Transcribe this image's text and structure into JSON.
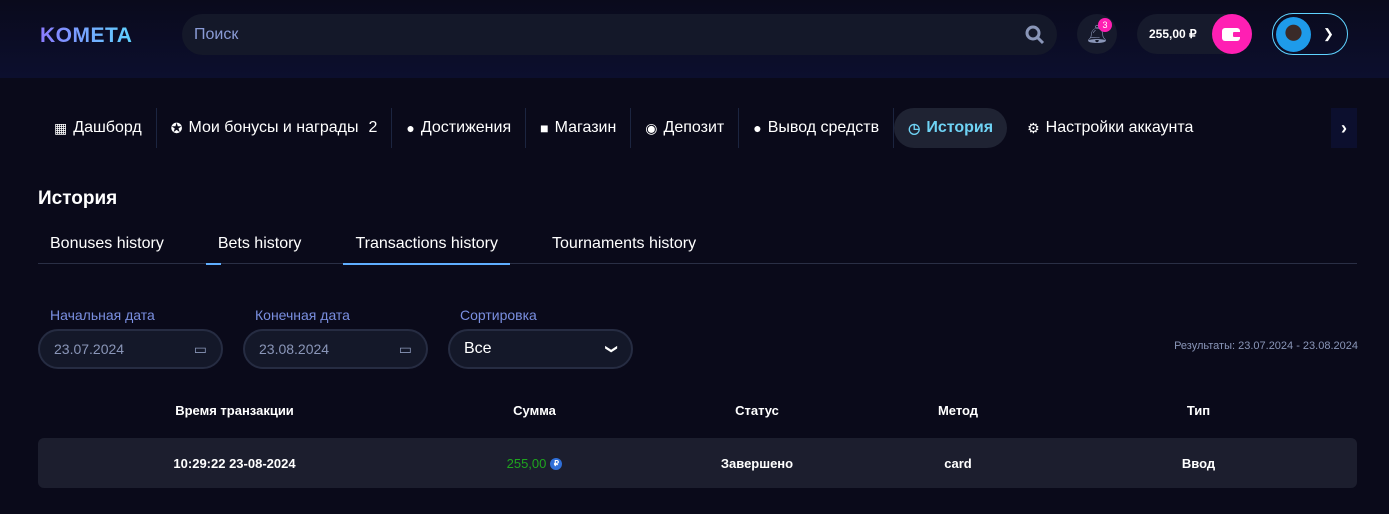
{
  "header": {
    "logo": "KOMETA",
    "search_placeholder": "Поиск",
    "notifications_count": "3",
    "balance": "255,00 ₽"
  },
  "nav": {
    "items": [
      {
        "label": "Дашборд",
        "icon": "dashboard-icon"
      },
      {
        "label": "Мои бонусы и награды",
        "count": "2",
        "icon": "gift-icon"
      },
      {
        "label": "Достижения",
        "icon": "award-icon"
      },
      {
        "label": "Магазин",
        "icon": "shop-icon"
      },
      {
        "label": "Депозит",
        "icon": "deposit-icon"
      },
      {
        "label": "Вывод средств",
        "icon": "money-bag-icon"
      },
      {
        "label": "История",
        "icon": "history-icon",
        "active": true
      },
      {
        "label": "Настройки аккаунта",
        "icon": "gear-icon"
      }
    ]
  },
  "page_title": "История",
  "tabs": [
    {
      "label": "Bonuses history"
    },
    {
      "label": "Bets history"
    },
    {
      "label": "Transactions history",
      "active": true
    },
    {
      "label": "Tournaments history"
    }
  ],
  "filters": {
    "start_label": "Начальная дата",
    "start_value": "23.07.2024",
    "end_label": "Конечная дата",
    "end_value": "23.08.2024",
    "sort_label": "Сортировка",
    "sort_value": "Все"
  },
  "results": "Результаты: 23.07.2024 - 23.08.2024",
  "table": {
    "headers": [
      "Время транзакции",
      "Сумма",
      "Статус",
      "Метод",
      "Тип"
    ],
    "rows": [
      {
        "time": "10:29:22 23-08-2024",
        "amount": "255,00",
        "currency": "₽",
        "status": "Завершено",
        "method": "card",
        "type": "Ввод"
      }
    ]
  },
  "colors": {
    "accent": "#5fd3ff",
    "pink": "#ff1fb3",
    "amount": "#1fa61f"
  }
}
